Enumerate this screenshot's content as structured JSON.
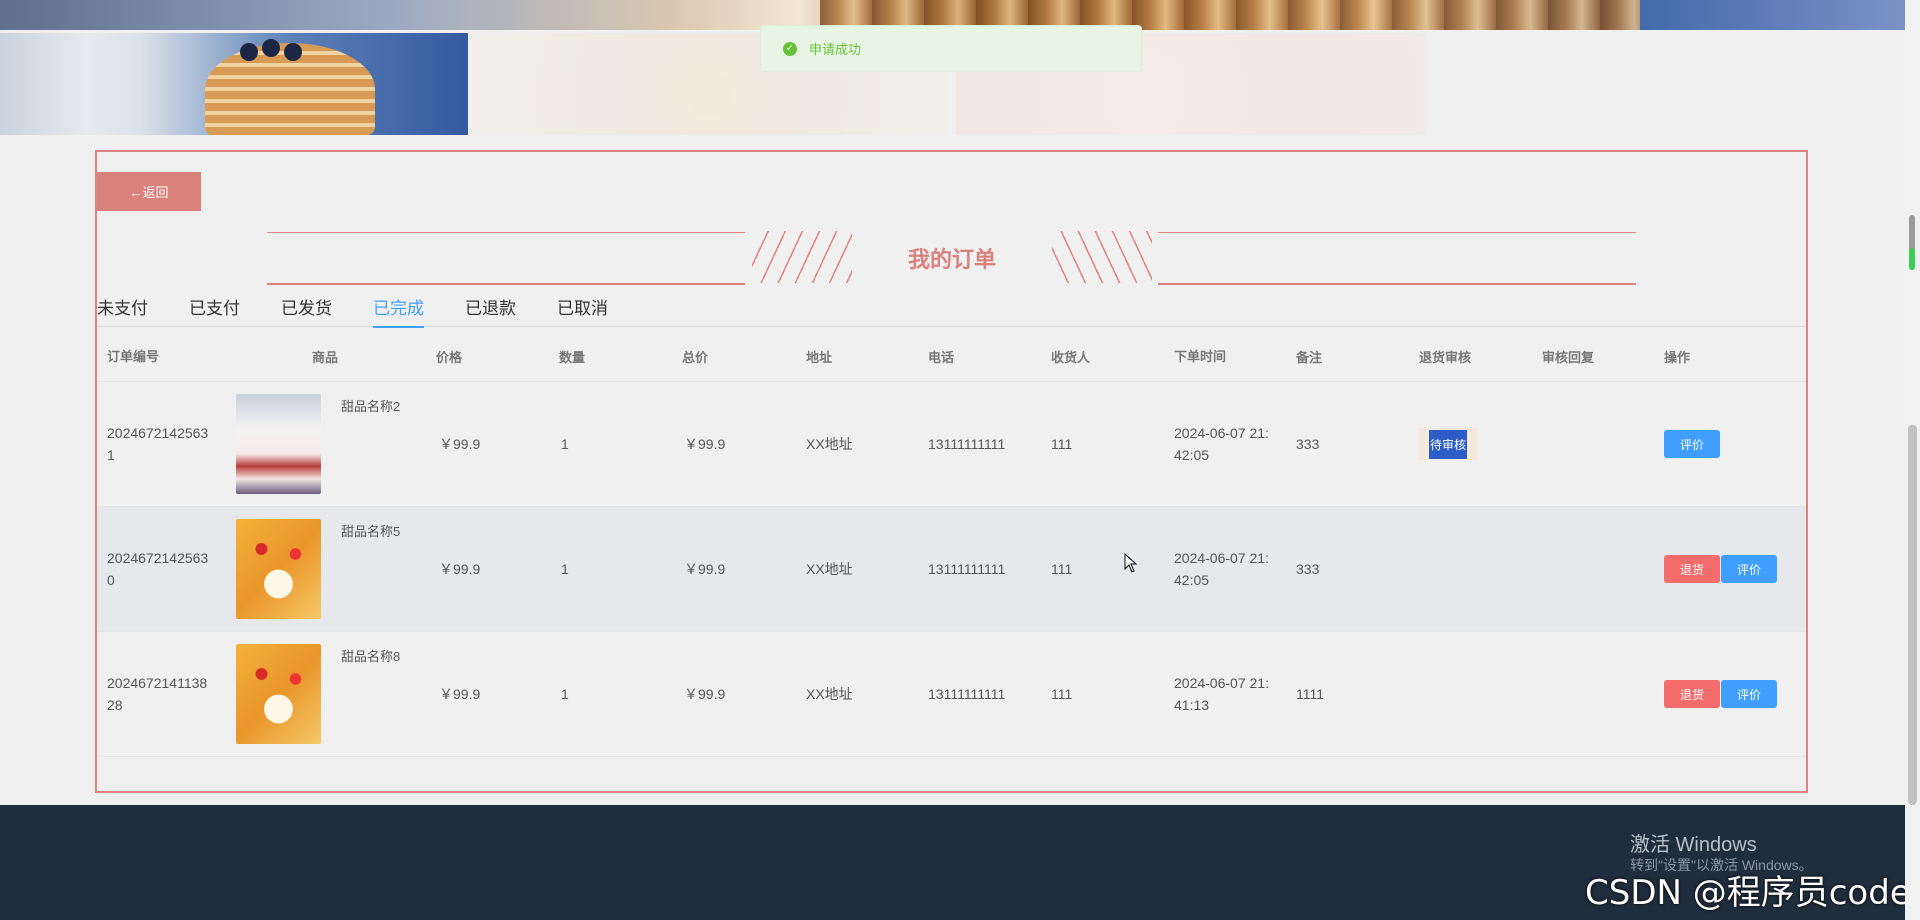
{
  "toast": {
    "message": "申请成功"
  },
  "nav": {
    "back_label": "←返回"
  },
  "page": {
    "title": "我的订单"
  },
  "tabs": [
    {
      "label": "未支付"
    },
    {
      "label": "已支付"
    },
    {
      "label": "已发货"
    },
    {
      "label": "已完成",
      "active": true
    },
    {
      "label": "已退款"
    },
    {
      "label": "已取消"
    }
  ],
  "table": {
    "headers": [
      "订单编号",
      "商品",
      "价格",
      "数量",
      "总价",
      "地址",
      "电话",
      "收货人",
      "下单时间",
      "备注",
      "退货审核",
      "审核回复",
      "操作"
    ],
    "rows": [
      {
        "order_id_l1": "2024672142563",
        "order_id_l2": "1",
        "product": "甜品名称2",
        "image": "cake-icon",
        "price": "￥99.9",
        "qty": "1",
        "total": "￥99.9",
        "address": "XX地址",
        "phone": "13111111111",
        "receiver": "111",
        "time_l1": "2024-06-07 21:",
        "time_l2": "42:05",
        "note": "333",
        "return_status": "待审核",
        "reply": "",
        "actions": [
          "评价"
        ]
      },
      {
        "order_id_l1": "2024672142563",
        "order_id_l2": "0",
        "product": "甜品名称5",
        "image": "tart-icon",
        "price": "￥99.9",
        "qty": "1",
        "total": "￥99.9",
        "address": "XX地址",
        "phone": "13111111111",
        "receiver": "111",
        "time_l1": "2024-06-07 21:",
        "time_l2": "42:05",
        "note": "333",
        "return_status": "",
        "reply": "",
        "actions": [
          "退货",
          "评价"
        ]
      },
      {
        "order_id_l1": "2024672141138",
        "order_id_l2": "28",
        "product": "甜品名称8",
        "image": "tart-icon",
        "price": "￥99.9",
        "qty": "1",
        "total": "￥99.9",
        "address": "XX地址",
        "phone": "13111111111",
        "receiver": "111",
        "time_l1": "2024-06-07 21:",
        "time_l2": "41:13",
        "note": "1111",
        "return_status": "",
        "reply": "",
        "actions": [
          "退货",
          "评价"
        ]
      }
    ]
  },
  "watermark": {
    "line1": "激活 Windows",
    "line2": "转到\"设置\"以激活 Windows。",
    "csdn": "CSDN @程序员code"
  },
  "colors": {
    "accent": "#d9817b",
    "primary_blue": "#409eff",
    "danger": "#f56c6c",
    "success": "#67c23a",
    "footer": "#1f2d3d"
  }
}
